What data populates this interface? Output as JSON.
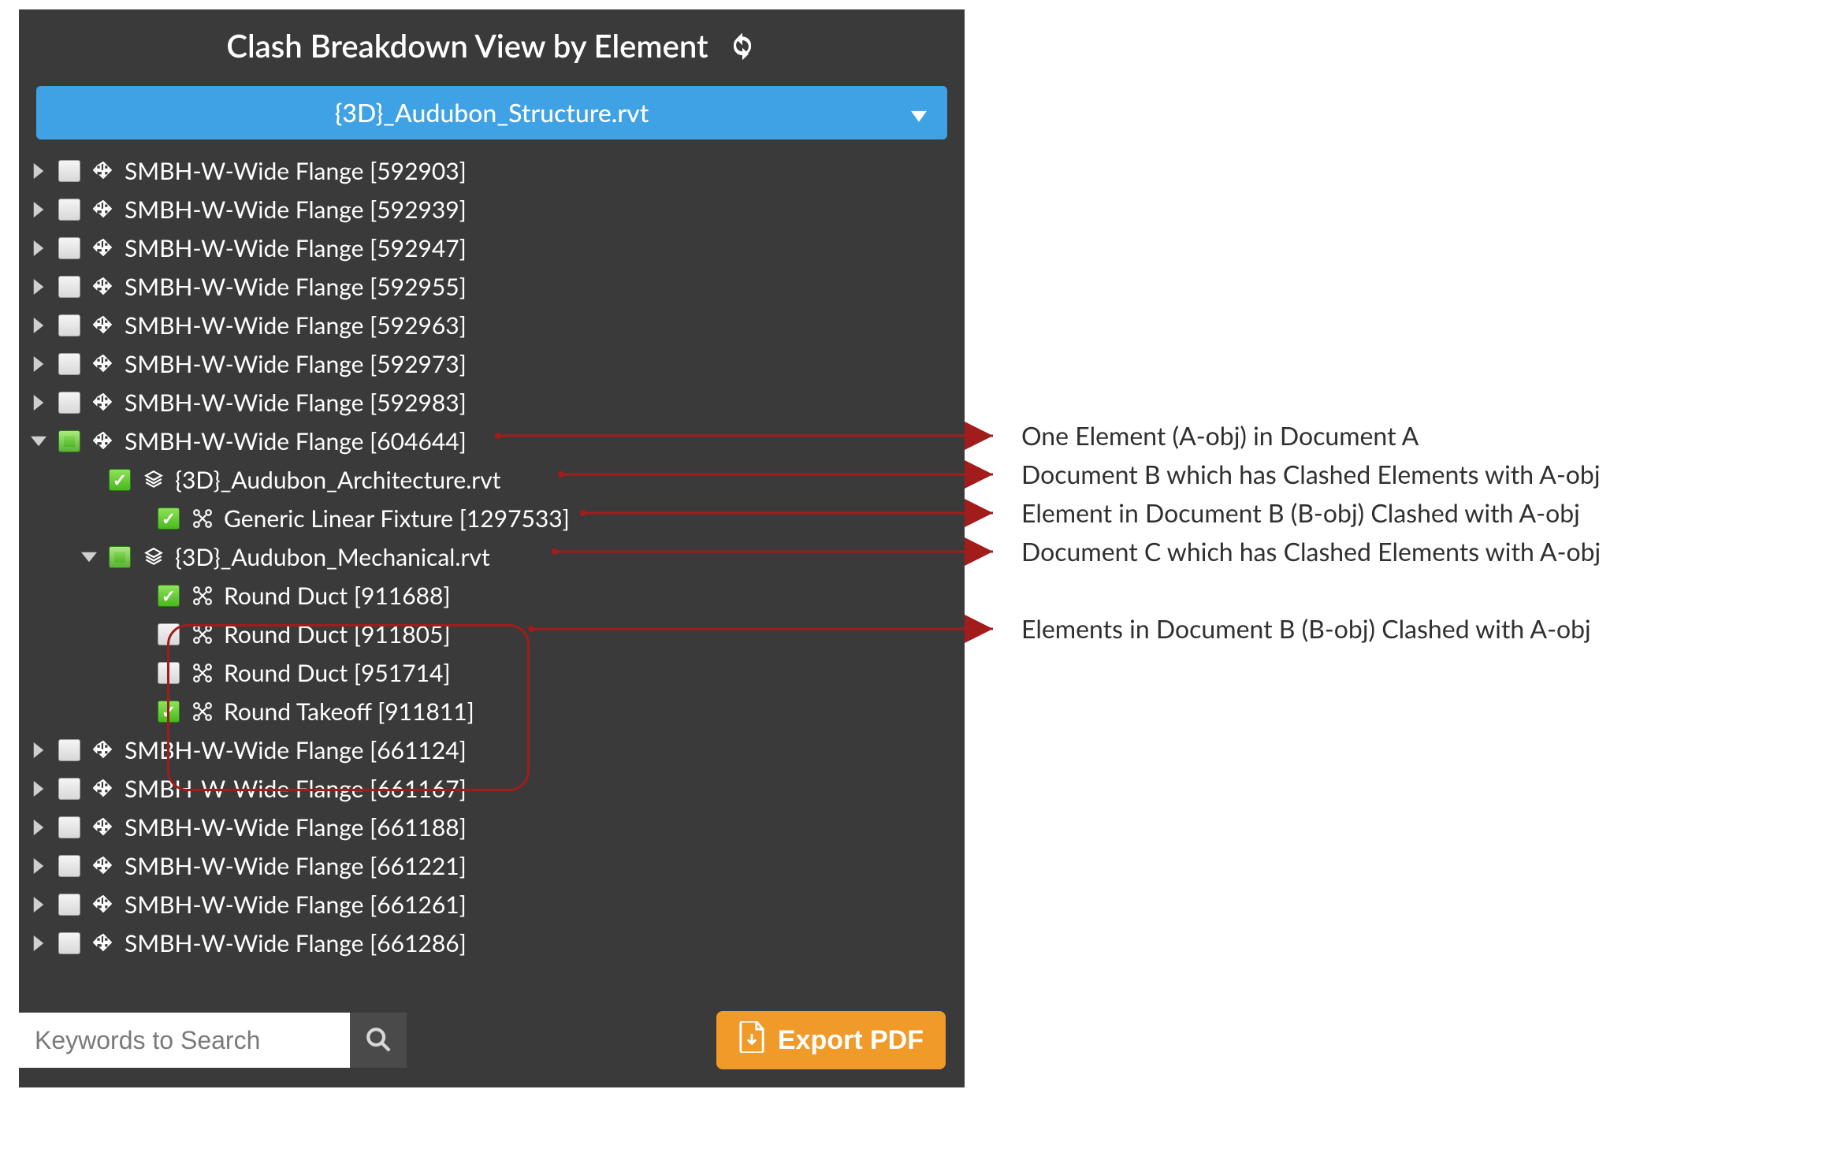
{
  "colors": {
    "panelBg": "#3a3a3a",
    "accent": "#3ea2e5",
    "export": "#f09a2a",
    "arrow": "#a21c1c"
  },
  "header": {
    "title": "Clash Breakdown View by Element",
    "refreshIcon": "refresh"
  },
  "dropdown": {
    "selected": "{3D}_Audubon_Structure.rvt"
  },
  "search": {
    "placeholder": "Keywords to Search",
    "value": ""
  },
  "export": {
    "label": "Export PDF"
  },
  "tree": [
    {
      "lvl": 0,
      "toggle": "closed",
      "check": "unchecked",
      "icon": "move",
      "label": "SMBH-W-Wide Flange [592903]"
    },
    {
      "lvl": 0,
      "toggle": "closed",
      "check": "unchecked",
      "icon": "move",
      "label": "SMBH-W-Wide Flange [592939]"
    },
    {
      "lvl": 0,
      "toggle": "closed",
      "check": "unchecked",
      "icon": "move",
      "label": "SMBH-W-Wide Flange [592947]"
    },
    {
      "lvl": 0,
      "toggle": "closed",
      "check": "unchecked",
      "icon": "move",
      "label": "SMBH-W-Wide Flange [592955]"
    },
    {
      "lvl": 0,
      "toggle": "closed",
      "check": "unchecked",
      "icon": "move",
      "label": "SMBH-W-Wide Flange [592963]"
    },
    {
      "lvl": 0,
      "toggle": "closed",
      "check": "unchecked",
      "icon": "move",
      "label": "SMBH-W-Wide Flange [592973]"
    },
    {
      "lvl": 0,
      "toggle": "closed",
      "check": "unchecked",
      "icon": "move",
      "label": "SMBH-W-Wide Flange [592983]"
    },
    {
      "lvl": 0,
      "toggle": "open",
      "check": "mixed",
      "icon": "move",
      "label": "SMBH-W-Wide Flange [604644]",
      "annot": 0
    },
    {
      "lvl": 1,
      "toggle": "blank",
      "check": "checked",
      "icon": "stack",
      "label": "{3D}_Audubon_Architecture.rvt",
      "annot": 1
    },
    {
      "lvl": 2,
      "toggle": "blank",
      "check": "checked",
      "icon": "burst",
      "label": "Generic Linear Fixture [1297533]",
      "annot": 2
    },
    {
      "lvl": 1,
      "toggle": "open",
      "check": "mixed",
      "icon": "stack",
      "label": "{3D}_Audubon_Mechanical.rvt",
      "annot": 3
    },
    {
      "lvl": 2,
      "toggle": "blank",
      "check": "checked",
      "icon": "burst",
      "label": "Round Duct [911688]"
    },
    {
      "lvl": 2,
      "toggle": "blank",
      "check": "unchecked",
      "icon": "burst",
      "label": "Round Duct [911805]",
      "annot": 4
    },
    {
      "lvl": 2,
      "toggle": "blank",
      "check": "unchecked",
      "icon": "burst",
      "label": "Round Duct [951714]"
    },
    {
      "lvl": 2,
      "toggle": "blank",
      "check": "checked",
      "icon": "burst",
      "label": "Round Takeoff [911811]"
    },
    {
      "lvl": 0,
      "toggle": "closed",
      "check": "unchecked",
      "icon": "move",
      "label": "SMBH-W-Wide Flange [661124]"
    },
    {
      "lvl": 0,
      "toggle": "closed",
      "check": "unchecked",
      "icon": "move",
      "label": "SMBH-W-Wide Flange [661167]"
    },
    {
      "lvl": 0,
      "toggle": "closed",
      "check": "unchecked",
      "icon": "move",
      "label": "SMBH-W-Wide Flange [661188]"
    },
    {
      "lvl": 0,
      "toggle": "closed",
      "check": "unchecked",
      "icon": "move",
      "label": "SMBH-W-Wide Flange [661221]"
    },
    {
      "lvl": 0,
      "toggle": "closed",
      "check": "unchecked",
      "icon": "move",
      "label": "SMBH-W-Wide Flange [661261]"
    },
    {
      "lvl": 0,
      "toggle": "closed",
      "check": "unchecked",
      "icon": "move",
      "label": "SMBH-W-Wide Flange [661286]"
    }
  ],
  "annotations": [
    {
      "text": "One Element (A-obj) in Document A",
      "rowIndex": 7,
      "tailX": 608
    },
    {
      "text": "Document B which has Clashed Elements with A-obj",
      "rowIndex": 8,
      "tailX": 688
    },
    {
      "text": "Element in Document B (B-obj) Clashed with A-obj",
      "rowIndex": 9,
      "tailX": 716
    },
    {
      "text": "Document C which has Clashed Elements with A-obj",
      "rowIndex": 10,
      "tailX": 680
    },
    {
      "text": "Elements in Document B (B-obj) Clashed with A-obj",
      "rowIndex": 12,
      "tailX": 650
    }
  ]
}
